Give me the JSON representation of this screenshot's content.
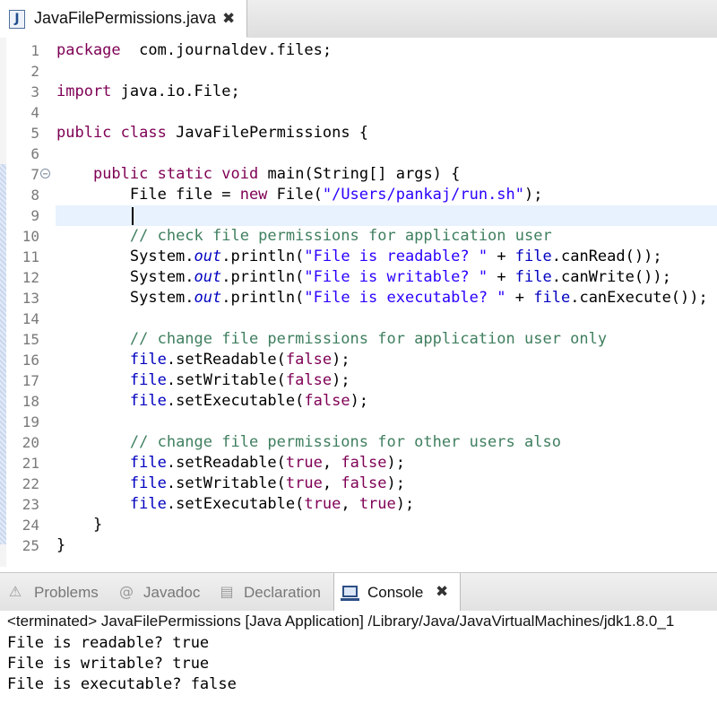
{
  "editor": {
    "tab": {
      "icon": "java-file-icon",
      "icon_glyph": "J",
      "title": "JavaFilePermissions.java",
      "close_glyph": "✖"
    },
    "lines": [
      {
        "num": "1",
        "tokens": [
          [
            "kw",
            "package"
          ],
          [
            "",
            "  com.journaldev.files;"
          ]
        ]
      },
      {
        "num": "2",
        "tokens": []
      },
      {
        "num": "3",
        "tokens": [
          [
            "kw",
            "import"
          ],
          [
            "",
            " java.io.File;"
          ]
        ]
      },
      {
        "num": "4",
        "tokens": []
      },
      {
        "num": "5",
        "tokens": [
          [
            "kw",
            "public"
          ],
          [
            "",
            " "
          ],
          [
            "kw",
            "class"
          ],
          [
            "",
            " JavaFilePermissions {"
          ]
        ]
      },
      {
        "num": "6",
        "tokens": []
      },
      {
        "num": "7",
        "fold": true,
        "tokens": [
          [
            "",
            "    "
          ],
          [
            "kw",
            "public"
          ],
          [
            "",
            " "
          ],
          [
            "kw",
            "static"
          ],
          [
            "",
            " "
          ],
          [
            "kw",
            "void"
          ],
          [
            "",
            " main(String[] args) {"
          ]
        ]
      },
      {
        "num": "8",
        "tokens": [
          [
            "",
            "        File file = "
          ],
          [
            "kw",
            "new"
          ],
          [
            "",
            " File("
          ],
          [
            "str",
            "\"/Users/pankaj/run.sh\""
          ],
          [
            "",
            ");"
          ]
        ]
      },
      {
        "num": "9",
        "current": true,
        "tokens": []
      },
      {
        "num": "10",
        "tokens": [
          [
            "",
            "        "
          ],
          [
            "cm",
            "// check file permissions for application user"
          ]
        ]
      },
      {
        "num": "11",
        "tokens": [
          [
            "",
            "        System."
          ],
          [
            "sfld",
            "out"
          ],
          [
            "",
            ".println("
          ],
          [
            "str",
            "\"File is readable? \""
          ],
          [
            "",
            " + "
          ],
          [
            "fld",
            "file"
          ],
          [
            "",
            ".canRead());"
          ]
        ]
      },
      {
        "num": "12",
        "tokens": [
          [
            "",
            "        System."
          ],
          [
            "sfld",
            "out"
          ],
          [
            "",
            ".println("
          ],
          [
            "str",
            "\"File is writable? \""
          ],
          [
            "",
            " + "
          ],
          [
            "fld",
            "file"
          ],
          [
            "",
            ".canWrite());"
          ]
        ]
      },
      {
        "num": "13",
        "tokens": [
          [
            "",
            "        System."
          ],
          [
            "sfld",
            "out"
          ],
          [
            "",
            ".println("
          ],
          [
            "str",
            "\"File is executable? \""
          ],
          [
            "",
            " + "
          ],
          [
            "fld",
            "file"
          ],
          [
            "",
            ".canExecute());"
          ]
        ]
      },
      {
        "num": "14",
        "tokens": []
      },
      {
        "num": "15",
        "tokens": [
          [
            "",
            "        "
          ],
          [
            "cm",
            "// change file permissions for application user only"
          ]
        ]
      },
      {
        "num": "16",
        "tokens": [
          [
            "",
            "        "
          ],
          [
            "fld",
            "file"
          ],
          [
            "",
            ".setReadable("
          ],
          [
            "kw",
            "false"
          ],
          [
            "",
            ");"
          ]
        ]
      },
      {
        "num": "17",
        "tokens": [
          [
            "",
            "        "
          ],
          [
            "fld",
            "file"
          ],
          [
            "",
            ".setWritable("
          ],
          [
            "kw",
            "false"
          ],
          [
            "",
            ");"
          ]
        ]
      },
      {
        "num": "18",
        "tokens": [
          [
            "",
            "        "
          ],
          [
            "fld",
            "file"
          ],
          [
            "",
            ".setExecutable("
          ],
          [
            "kw",
            "false"
          ],
          [
            "",
            ");"
          ]
        ]
      },
      {
        "num": "19",
        "tokens": []
      },
      {
        "num": "20",
        "tokens": [
          [
            "",
            "        "
          ],
          [
            "cm",
            "// change file permissions for other users also"
          ]
        ]
      },
      {
        "num": "21",
        "tokens": [
          [
            "",
            "        "
          ],
          [
            "fld",
            "file"
          ],
          [
            "",
            ".setReadable("
          ],
          [
            "kw",
            "true"
          ],
          [
            "",
            ", "
          ],
          [
            "kw",
            "false"
          ],
          [
            "",
            ");"
          ]
        ]
      },
      {
        "num": "22",
        "tokens": [
          [
            "",
            "        "
          ],
          [
            "fld",
            "file"
          ],
          [
            "",
            ".setWritable("
          ],
          [
            "kw",
            "true"
          ],
          [
            "",
            ", "
          ],
          [
            "kw",
            "false"
          ],
          [
            "",
            ");"
          ]
        ]
      },
      {
        "num": "23",
        "tokens": [
          [
            "",
            "        "
          ],
          [
            "fld",
            "file"
          ],
          [
            "",
            ".setExecutable("
          ],
          [
            "kw",
            "true"
          ],
          [
            "",
            ", "
          ],
          [
            "kw",
            "true"
          ],
          [
            "",
            ");"
          ]
        ]
      },
      {
        "num": "24",
        "tokens": [
          [
            "",
            "    }"
          ]
        ]
      },
      {
        "num": "25",
        "tokens": [
          [
            "",
            "}"
          ]
        ]
      }
    ]
  },
  "views": {
    "tabs": [
      {
        "name": "tab-problems",
        "icon": "problems-icon",
        "icon_glyph": "⚠",
        "label": "Problems",
        "active": false
      },
      {
        "name": "tab-javadoc",
        "icon": "javadoc-icon",
        "icon_glyph": "@",
        "label": "Javadoc",
        "active": false
      },
      {
        "name": "tab-declaration",
        "icon": "declaration-icon",
        "icon_glyph": "▤",
        "label": "Declaration",
        "active": false
      },
      {
        "name": "tab-console",
        "icon": "console-icon",
        "icon_glyph": "",
        "label": "Console",
        "active": true,
        "close_glyph": "✖"
      }
    ]
  },
  "console": {
    "status": "<terminated> JavaFilePermissions [Java Application] /Library/Java/JavaVirtualMachines/jdk1.8.0_1",
    "output": [
      "File is readable? true",
      "File is writable? true",
      "File is executable? false"
    ]
  },
  "colors": {
    "keyword": "#7f0055",
    "string": "#2a00ff",
    "comment": "#3f7f5f",
    "field": "#0000c0",
    "current_line": "#e8f2fe"
  }
}
